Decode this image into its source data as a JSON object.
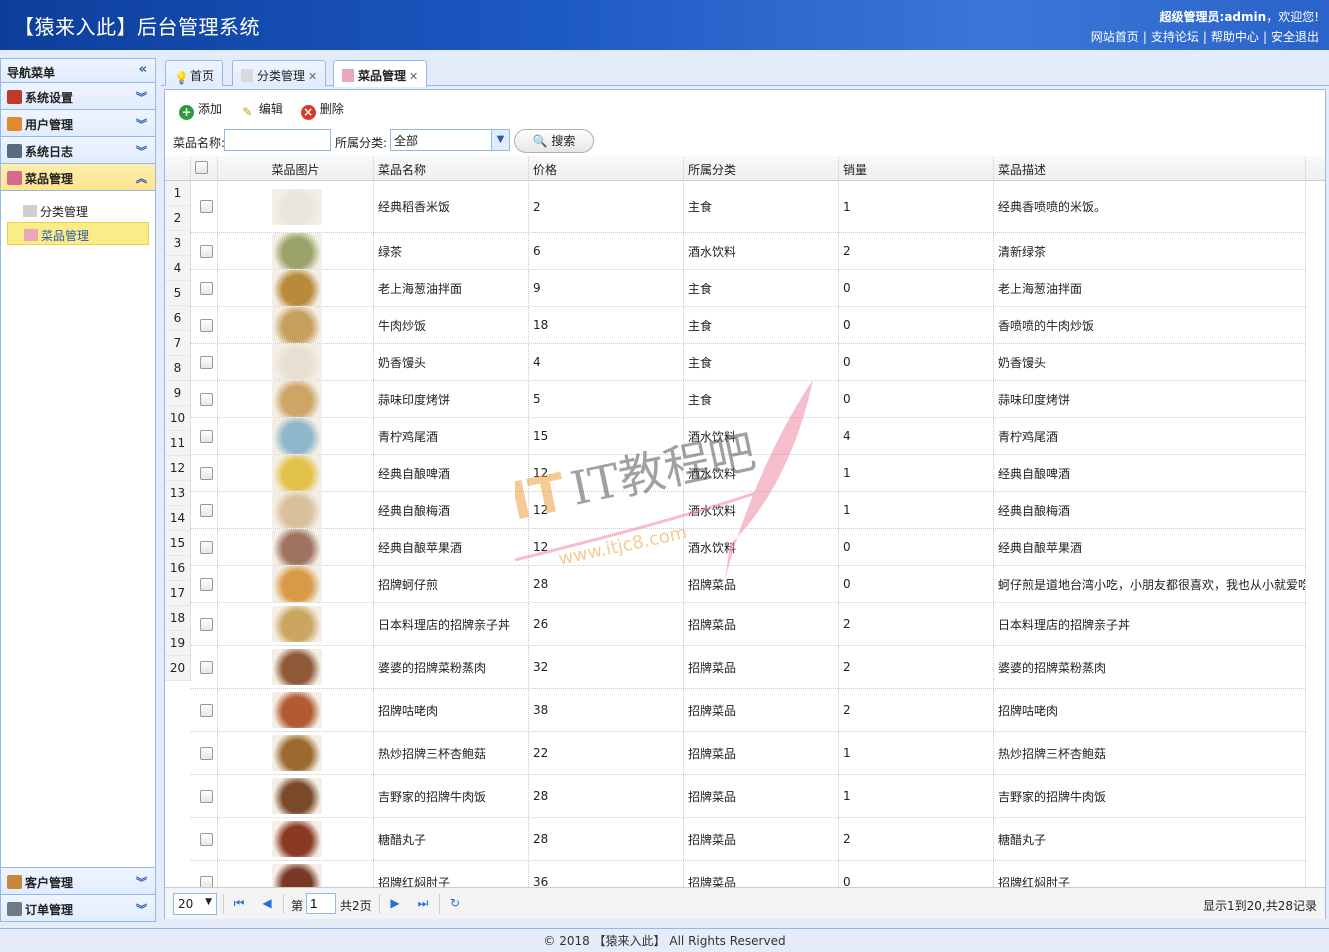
{
  "header": {
    "title": "【猿来入此】后台管理系统",
    "user_role": "超级管理员:admin",
    "welcome": "，欢迎您!",
    "links": [
      "网站首页",
      "支持论坛",
      "帮助中心",
      "安全退出"
    ]
  },
  "sidebar": {
    "title": "导航菜单",
    "sections_top": [
      {
        "label": "系统设置",
        "color": "#c0392b"
      },
      {
        "label": "用户管理",
        "color": "#e08a2c"
      },
      {
        "label": "系统日志",
        "color": "#5a6b80"
      },
      {
        "label": "菜品管理",
        "color": "#d66a8c",
        "active": true
      }
    ],
    "sub_items": [
      {
        "label": "分类管理"
      },
      {
        "label": "菜品管理",
        "selected": true
      }
    ],
    "sections_bottom": [
      {
        "label": "客户管理",
        "color": "#c4873c"
      },
      {
        "label": "订单管理",
        "color": "#6f7a87"
      }
    ]
  },
  "tabs": [
    {
      "label": "首页",
      "closable": false
    },
    {
      "label": "分类管理",
      "closable": true
    },
    {
      "label": "菜品管理",
      "closable": true,
      "active": true
    }
  ],
  "toolbar": {
    "add": "添加",
    "edit": "编辑",
    "delete": "删除"
  },
  "search": {
    "name_label": "菜品名称:",
    "name_value": "",
    "category_label": "所属分类:",
    "category_value": "全部",
    "button": "搜索"
  },
  "grid": {
    "columns": [
      "菜品图片",
      "菜品名称",
      "价格",
      "所属分类",
      "销量",
      "菜品描述"
    ],
    "row_numbers": [
      "1",
      "2",
      "3",
      "4",
      "5",
      "6",
      "7",
      "8",
      "9",
      "10",
      "11",
      "12",
      "13",
      "14",
      "15",
      "16",
      "17",
      "18",
      "19",
      "20"
    ],
    "rows": [
      {
        "name": "经典稻香米饭",
        "price": "2",
        "category": "主食",
        "sales": "1",
        "desc": "经典香喷喷的米饭。",
        "color": "#e8e6df"
      },
      {
        "name": "绿茶",
        "price": "6",
        "category": "酒水饮料",
        "sales": "2",
        "desc": "清新绿茶",
        "color": "#9aa46a"
      },
      {
        "name": "老上海葱油拌面",
        "price": "9",
        "category": "主食",
        "sales": "0",
        "desc": "老上海葱油拌面",
        "color": "#b88a3a"
      },
      {
        "name": "牛肉炒饭",
        "price": "18",
        "category": "主食",
        "sales": "0",
        "desc": "香喷喷的牛肉炒饭",
        "color": "#c7a060"
      },
      {
        "name": "奶香馒头",
        "price": "4",
        "category": "主食",
        "sales": "0",
        "desc": "奶香馒头",
        "color": "#e6dfd2"
      },
      {
        "name": "蒜味印度烤饼",
        "price": "5",
        "category": "主食",
        "sales": "0",
        "desc": "蒜味印度烤饼",
        "color": "#cfa565"
      },
      {
        "name": "青柠鸡尾酒",
        "price": "15",
        "category": "酒水饮料",
        "sales": "4",
        "desc": "青柠鸡尾酒",
        "color": "#8fb7cc"
      },
      {
        "name": "经典自酿啤酒",
        "price": "12",
        "category": "酒水饮料",
        "sales": "1",
        "desc": "经典自酿啤酒",
        "color": "#e3c24a"
      },
      {
        "name": "经典自酿梅酒",
        "price": "12",
        "category": "酒水饮料",
        "sales": "1",
        "desc": "经典自酿梅酒",
        "color": "#d8c09a"
      },
      {
        "name": "经典自酿苹果酒",
        "price": "12",
        "category": "酒水饮料",
        "sales": "0",
        "desc": "经典自酿苹果酒",
        "color": "#9e7460"
      },
      {
        "name": "招牌蚵仔煎",
        "price": "28",
        "category": "招牌菜品",
        "sales": "0",
        "desc": "蚵仔煎是道地台湾小吃，小朋友都很喜欢，我也从小就爱吃",
        "color": "#d99a48"
      },
      {
        "name": "日本料理店的招牌亲子丼",
        "price": "26",
        "category": "招牌菜品",
        "sales": "2",
        "desc": "日本料理店的招牌亲子丼",
        "color": "#caa660"
      },
      {
        "name": "婆婆的招牌菜粉蒸肉",
        "price": "32",
        "category": "招牌菜品",
        "sales": "2",
        "desc": "婆婆的招牌菜粉蒸肉",
        "color": "#8e5a38"
      },
      {
        "name": "招牌咕咾肉",
        "price": "38",
        "category": "招牌菜品",
        "sales": "2",
        "desc": "招牌咕咾肉",
        "color": "#b25a30"
      },
      {
        "name": "热炒招牌三杯杏鲍菇",
        "price": "22",
        "category": "招牌菜品",
        "sales": "1",
        "desc": "热炒招牌三杯杏鲍菇",
        "color": "#9c6a2e"
      },
      {
        "name": "吉野家的招牌牛肉饭",
        "price": "28",
        "category": "招牌菜品",
        "sales": "1",
        "desc": "吉野家的招牌牛肉饭",
        "color": "#7a4a2a"
      },
      {
        "name": "糖醋丸子",
        "price": "28",
        "category": "招牌菜品",
        "sales": "2",
        "desc": "糖醋丸子",
        "color": "#8a3a22"
      },
      {
        "name": "招牌红焖肘子",
        "price": "36",
        "category": "招牌菜品",
        "sales": "0",
        "desc": "招牌红焖肘子",
        "color": "#7a3826"
      }
    ]
  },
  "pager": {
    "page_size": "20",
    "page_prefix": "第",
    "page_value": "1",
    "page_total": "共2页",
    "info": "显示1到20,共28记录"
  },
  "footer": "© 2018 【猿来入此】 All Rights Reserved",
  "watermark": {
    "main": "IT教程吧",
    "url": "www.itjc8.com"
  }
}
